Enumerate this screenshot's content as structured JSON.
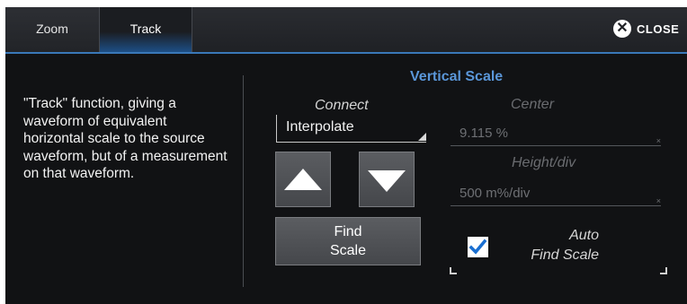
{
  "tabs": [
    {
      "label": "Zoom",
      "active": false
    },
    {
      "label": "Track",
      "active": true
    }
  ],
  "close": {
    "label": "CLOSE",
    "icon": "close-circle-icon"
  },
  "description": "\"Track\" function, giving a waveform of equivalent horizontal scale to the source waveform, but of a measurement on that waveform.",
  "vertical_scale": {
    "title": "Vertical Scale",
    "connect": {
      "label": "Connect",
      "value": "Interpolate"
    },
    "center": {
      "label": "Center",
      "value": "9.115 %",
      "clear_icon": "×"
    },
    "height_div": {
      "label": "Height/div",
      "value": "500 m%/div",
      "clear_icon": "×"
    },
    "find_scale": {
      "line1": "Find",
      "line2": "Scale"
    },
    "auto_find_scale": {
      "line1": "Auto",
      "line2": "Find Scale",
      "checked": true
    }
  },
  "colors": {
    "accent": "#3a78b8",
    "title_blue": "#5a96d8",
    "checkbox": "#1a6fd1",
    "panel_bg": "#111214"
  }
}
